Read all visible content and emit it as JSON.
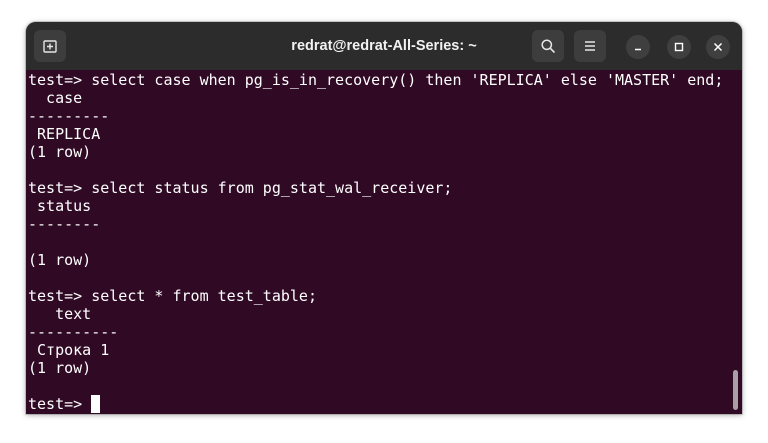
{
  "window": {
    "title": "redrat@redrat-All-Series: ~"
  },
  "icons": {
    "new_tab": "new-tab-icon",
    "search": "search-icon",
    "menu": "hamburger-menu-icon",
    "minimize": "minimize-icon",
    "maximize": "maximize-icon",
    "close": "close-icon"
  },
  "colors": {
    "terminal_bg": "#300a24",
    "titlebar_bg": "#2c2c2c",
    "text": "#ffffff"
  },
  "terminal": {
    "lines": [
      "test=> select case when pg_is_in_recovery() then 'REPLICA' else 'MASTER' end;",
      "  case",
      "---------",
      " REPLICA",
      "(1 row)",
      "",
      "test=> select status from pg_stat_wal_receiver;",
      " status",
      "--------",
      "",
      "(1 row)",
      "",
      "test=> select * from test_table;",
      "   text",
      "----------",
      " Строка 1",
      "(1 row)",
      ""
    ],
    "prompt": "test=> "
  }
}
